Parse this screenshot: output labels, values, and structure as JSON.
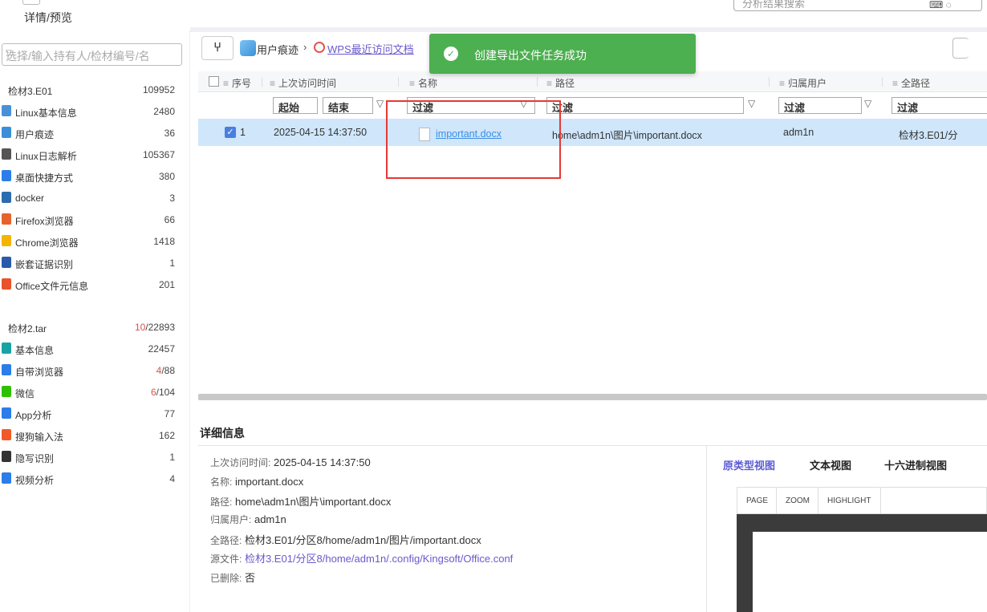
{
  "topbar": {
    "preview_tab": "详情/预览",
    "search_placeholder": "分析结果搜索"
  },
  "sidebar": {
    "select_placeholder": "选择/输入持有人/检材编号/名",
    "groups": [
      {
        "name": "检材3.E01",
        "count": "109952"
      },
      {
        "name": "检材2.tar",
        "count_red": "10",
        "count_rest": "/22893"
      }
    ],
    "items_group1": [
      {
        "label": "Linux基本信息",
        "count": "2480",
        "icon": "doc-icon",
        "color": "#4a90d9"
      },
      {
        "label": "用户痕迹",
        "count": "36",
        "icon": "user-trace-icon",
        "color": "#3b8fd9"
      },
      {
        "label": "Linux日志解析",
        "count": "105367",
        "icon": "log-icon",
        "color": "#555555"
      },
      {
        "label": "桌面快捷方式",
        "count": "380",
        "icon": "shortcut-icon",
        "color": "#2b7de9"
      },
      {
        "label": "docker",
        "count": "3",
        "icon": "docker-icon",
        "color": "#2b6cb0"
      },
      {
        "label": "Firefox浏览器",
        "count": "66",
        "icon": "firefox-icon",
        "color": "#e8632b"
      },
      {
        "label": "Chrome浏览器",
        "count": "1418",
        "icon": "chrome-icon",
        "color": "#f4b400"
      },
      {
        "label": "嵌套证据识别",
        "count": "1",
        "icon": "nested-evidence-icon",
        "color": "#2a5aa8"
      },
      {
        "label": "Office文件元信息",
        "count": "201",
        "icon": "office-icon",
        "color": "#e8532b"
      }
    ],
    "items_group2": [
      {
        "label": "基本信息",
        "count": "22457",
        "icon": "info-icon",
        "color": "#1aa3a3"
      },
      {
        "label": "自带浏览器",
        "count_red": "4",
        "count_rest": "/88",
        "icon": "browser-icon",
        "color": "#2b7de9"
      },
      {
        "label": "微信",
        "count_red": "6",
        "count_rest": "/104",
        "icon": "wechat-icon",
        "color": "#2dc100"
      },
      {
        "label": "App分析",
        "count": "77",
        "icon": "app-icon",
        "color": "#2b7de9"
      },
      {
        "label": "搜狗输入法",
        "count": "162",
        "icon": "sogou-icon",
        "color": "#f05a28"
      },
      {
        "label": "隐写识别",
        "count": "1",
        "icon": "stego-icon",
        "color": "#333333"
      },
      {
        "label": "视频分析",
        "count": "4",
        "icon": "video-analysis-icon",
        "color": "#2b7de9"
      }
    ]
  },
  "breadcrumb": {
    "item1": "用户痕迹",
    "separator": "›",
    "item2": "WPS最近访问文档"
  },
  "toast": {
    "message": "创建导出文件任务成功"
  },
  "table": {
    "columns": [
      "序号",
      "上次访问时间",
      "名称",
      "路径",
      "归属用户",
      "全路径"
    ],
    "filters": {
      "start": "起始",
      "end": "结束",
      "name_filter": "过滤",
      "path_filter": "过滤",
      "owner_filter": "过滤",
      "full_filter": "过滤"
    },
    "rows": [
      {
        "index": "1",
        "time": "2025-04-15 14:37:50",
        "name": "important.docx",
        "path": "home\\adm1n\\图片\\important.docx",
        "owner": "adm1n",
        "full": "检材3.E01/分"
      }
    ]
  },
  "detail": {
    "title": "详细信息",
    "fields": [
      {
        "key": "上次访问时间:",
        "value": "2025-04-15 14:37:50"
      },
      {
        "key": "名称:",
        "value": "important.docx"
      },
      {
        "key": "路径:",
        "value": "home\\adm1n\\图片\\important.docx"
      },
      {
        "key": "归属用户:",
        "value": "adm1n"
      },
      {
        "key": "全路径:",
        "value": "检材3.E01/分区8/home/adm1n/图片/important.docx"
      },
      {
        "key": "源文件:",
        "value": "检材3.E01/分区8/home/adm1n/.config/Kingsoft/Office.conf"
      },
      {
        "key": "已删除:",
        "value": "否"
      }
    ],
    "views": {
      "prototype": "原类型视图",
      "text": "文本视图",
      "hex": "十六进制视图"
    },
    "pdf_toolbar": {
      "page": "PAGE",
      "zoom": "ZOOM",
      "highlight": "HIGHLIGHT"
    }
  },
  "colors": {
    "toast_bg": "#4caf50",
    "selected_row": "#cfe6fb",
    "link": "#6a5acd",
    "highlight_box": "#e53935"
  }
}
